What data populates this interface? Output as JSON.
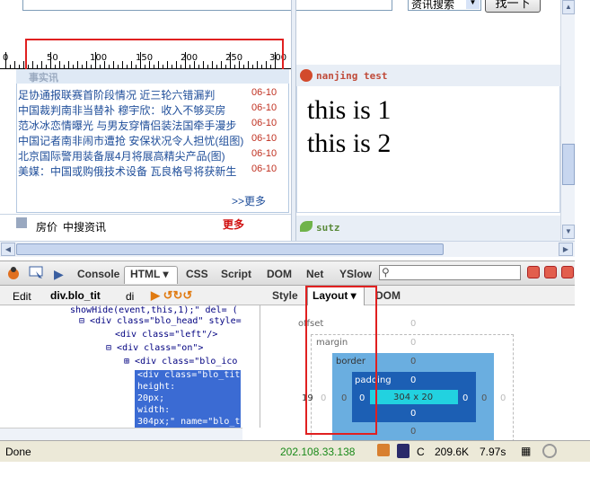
{
  "search": {
    "type_label": "资讯搜索",
    "button_label": "找一下"
  },
  "ruler": {
    "labels": [
      "0",
      "50",
      "100",
      "150",
      "200",
      "250",
      "300"
    ]
  },
  "news": {
    "section_title": "事实讯",
    "items": [
      {
        "title": "足协通报联赛首阶段情况 近三轮六错漏判",
        "date": "06-10"
      },
      {
        "title": "中国裁判南非当替补 穆宇欣：收入不够买房",
        "date": "06-10"
      },
      {
        "title": "范冰冰恋情曝光 与男友穿情侣装法国牵手漫步",
        "date": "06-10"
      },
      {
        "title": "中国记者南非闹市遭抢 安保状况令人担忧(组图)",
        "date": "06-10"
      },
      {
        "title": "北京国际警用装备展4月将展高精尖产品(图)",
        "date": "06-10"
      },
      {
        "title": "美媒：中国或购俄技术设备 瓦良格号将获新生",
        "date": "06-10"
      }
    ],
    "more": ">>更多"
  },
  "subtabs": {
    "house": "房价",
    "zs": "中搜资讯",
    "more": "更多"
  },
  "right": {
    "title": "nanjing test",
    "lines": [
      "this is 1",
      "this is 2"
    ],
    "title2": "sutz"
  },
  "firebug": {
    "tabs": [
      "Console",
      "HTML ▾",
      "CSS",
      "Script",
      "DOM",
      "Net",
      "YSlow"
    ],
    "breadcrumb": {
      "edit": "Edit",
      "current": "div.blo_tit",
      "prev": "di"
    },
    "side_tabs": {
      "style": "Style",
      "layout": "Layout ▾",
      "dom": "DOM"
    },
    "code_lines": [
      "showHide(event,this,1);\" del= (",
      "<div class=\"blo_head\" style=",
      "<div class=\"left\"/>",
      "<div class=\"on\">",
      "<div class=\"blo_ico"
    ],
    "selected_lines": [
      "<div class=\"blo_tit",
      "height:",
      "20px;",
      "width:",
      "304px;\" name=\"blo_t"
    ],
    "layout": {
      "offset_label": "offset",
      "offset_top": "0",
      "margin_label": "margin",
      "margin_top": "0",
      "margin_left": "0",
      "margin_right": "0",
      "margin_bottom": "0",
      "border_label": "border",
      "border_top": "0",
      "border_left": "0",
      "border_right": "0",
      "border_bottom": "0",
      "padding_label": "padding",
      "padding_top": "0",
      "padding_left": "0",
      "padding_right": "0",
      "padding_bottom": "0",
      "content_size": "304 x 20",
      "offset_left": "19",
      "outer_right": "0"
    }
  },
  "status": {
    "done": "Done",
    "ip": "202.108.33.138",
    "c": "C",
    "size": "209.6K",
    "time": "7.97s"
  }
}
